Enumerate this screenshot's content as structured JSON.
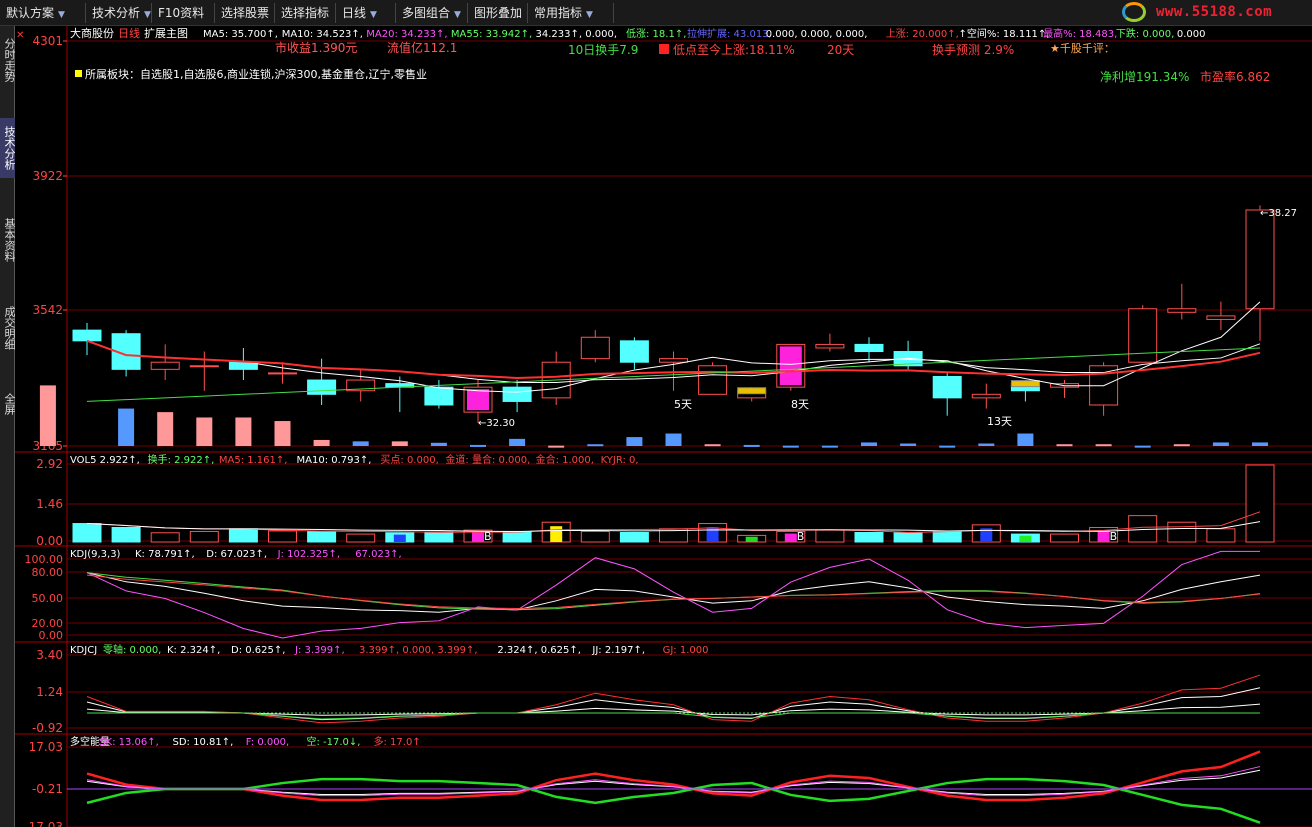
{
  "toolbar": [
    {
      "label": "默认方案",
      "arrow": true
    },
    {
      "label": "技术分析",
      "arrow": true
    },
    {
      "label": "F10资料",
      "arrow": false
    },
    {
      "label": "选择股票",
      "arrow": false
    },
    {
      "label": "选择指标",
      "arrow": false
    },
    {
      "label": "日线",
      "arrow": true
    },
    {
      "label": "多图组合",
      "arrow": true
    },
    {
      "label": "图形叠加",
      "arrow": false
    },
    {
      "label": "常用指标",
      "arrow": true
    }
  ],
  "logo_text": "www.55188.com",
  "sidebar": [
    {
      "label": "分时走势",
      "active": false
    },
    {
      "label": "技术分析",
      "active": true
    },
    {
      "label": "基本资料",
      "active": false
    },
    {
      "label": "成交明细",
      "active": false
    },
    {
      "label": "全屏",
      "active": false
    }
  ],
  "main_panel": {
    "stock_name": "大商股份",
    "period": "日线",
    "indicator": "扩展主图",
    "ma_line": [
      {
        "text": "MA5: 35.700↑,",
        "color": "#ffffff"
      },
      {
        "text": "MA10: 34.523↑,",
        "color": "#ffffff"
      },
      {
        "text": "MA20: 34.233↑,",
        "color": "#ff55ff"
      },
      {
        "text": "MA55: 33.942↑,",
        "color": "#66ff66"
      },
      {
        "text": "34.233↑, 0.000,",
        "color": "#ffffff"
      },
      {
        "text": "低涨: 18.1↑,",
        "color": "#66ff66"
      },
      {
        "text": "拉伸扩展: 43.013,",
        "color": "#6666ff"
      },
      {
        "text": "0.000, 0.000, 0.000,",
        "color": "#ffffff"
      },
      {
        "text": "上涨: 20.000↑,",
        "color": "#ff4444"
      },
      {
        "text": "↑空间%: 18.111↑,",
        "color": "#ffffff"
      },
      {
        "text": "最高%: 18.483,",
        "color": "#ff55ff"
      },
      {
        "text": "下跌: 0.000,",
        "color": "#66ff66"
      },
      {
        "text": "0.000",
        "color": "#ffffff"
      }
    ],
    "info_shiyi": "市收益1.390元",
    "info_liutong": "流值亿112.1",
    "info_huanshou10": "10日换手7.9",
    "info_didian": "低点至今上涨:18.11%",
    "info_days": "20天",
    "info_huanshou_pred": "换手预测 2.9%",
    "info_qiangu": "★千股千评：",
    "info_bankuai": "所属板块：自选股1,自选股6,商业连锁,沪深300,基金重仓,辽宁,零售业",
    "info_jinglirun": "净利增191.34%",
    "info_shiying": "市盈率6.862",
    "y_labels": [
      "4301",
      "3922",
      "3542",
      "3165"
    ],
    "annot_low": "←32.30",
    "annot_high": "←38.27",
    "annot_5": "5天",
    "annot_8": "8天",
    "annot_13": "13天"
  },
  "vol_panel": {
    "header": [
      {
        "text": "VOL5 2.922↑,",
        "color": "#ffffff"
      },
      {
        "text": "换手: 2.922↑,",
        "color": "#66ff66"
      },
      {
        "text": "MA5: 1.161↑,",
        "color": "#ff4444"
      },
      {
        "text": "MA10: 0.793↑,",
        "color": "#ffffff"
      },
      {
        "text": "买点: 0.000,",
        "color": "#ff4444"
      },
      {
        "text": "金道: 量合: 0.000,",
        "color": "#ff4444"
      },
      {
        "text": "金合: 1.000,",
        "color": "#ff4444"
      },
      {
        "text": "KYJR: 0,",
        "color": "#ff4444"
      }
    ],
    "y_labels": [
      "2.92",
      "1.46",
      "0.00"
    ],
    "b_marks": [
      "B",
      "B",
      "B"
    ]
  },
  "kdj_panel": {
    "header": [
      {
        "text": "KDJ(9,3,3)",
        "color": "#ffffff"
      },
      {
        "text": "K: 78.791↑,",
        "color": "#ffffff"
      },
      {
        "text": "D: 67.023↑,",
        "color": "#ffffff"
      },
      {
        "text": "J: 102.325↑,",
        "color": "#ff55ff"
      },
      {
        "text": "67.023↑,",
        "color": "#ff55ff"
      }
    ],
    "y_labels": [
      "100.00",
      "80.00",
      "50.00",
      "20.00",
      "0.00"
    ]
  },
  "kdjcj_panel": {
    "header": [
      {
        "text": "KDJCJ",
        "color": "#ffffff"
      },
      {
        "text": "零轴: 0.000,",
        "color": "#66ff66"
      },
      {
        "text": "K: 2.324↑,",
        "color": "#ffffff"
      },
      {
        "text": "D: 0.625↑,",
        "color": "#ffffff"
      },
      {
        "text": "J: 3.399↑,",
        "color": "#ff55ff"
      },
      {
        "text": "3.399↑, 0.000, 3.399↑,",
        "color": "#ff4444"
      },
      {
        "text": "2.324↑, 0.625↑,",
        "color": "#ffffff"
      },
      {
        "text": "JJ: 2.197↑,",
        "color": "#ffffff"
      },
      {
        "text": "GJ: 1.000",
        "color": "#ff4444"
      }
    ],
    "y_labels": [
      "3.40",
      "1.24",
      "-0.92"
    ]
  },
  "dkn_panel": {
    "header": [
      {
        "text": "多空能量",
        "color": "#ffffff"
      },
      {
        "text": "SK: 13.06↑,",
        "color": "#ff55ff"
      },
      {
        "text": "SD: 10.81↑,",
        "color": "#ffffff"
      },
      {
        "text": "F: 0.000,",
        "color": "#ff55ff"
      },
      {
        "text": "空: -17.0↓,",
        "color": "#66ff66"
      },
      {
        "text": "多: 17.0↑",
        "color": "#ff4444"
      }
    ],
    "y_labels": [
      "17.03",
      "-0.21",
      "-17.03"
    ]
  },
  "chart_data": {
    "type": "candlestick",
    "price_range": [
      31.65,
      43.01
    ],
    "candles": [
      {
        "o": 34.9,
        "c": 34.6,
        "h": 35.1,
        "l": 34.2,
        "up": false
      },
      {
        "o": 34.8,
        "c": 33.8,
        "h": 34.9,
        "l": 33.6,
        "up": false
      },
      {
        "o": 33.8,
        "c": 34.0,
        "h": 34.5,
        "l": 33.5,
        "up": true
      },
      {
        "o": 33.9,
        "c": 33.9,
        "h": 34.3,
        "l": 33.2,
        "up": true
      },
      {
        "o": 34.0,
        "c": 33.8,
        "h": 34.4,
        "l": 33.5,
        "up": false
      },
      {
        "o": 33.7,
        "c": 33.7,
        "h": 34.0,
        "l": 33.4,
        "up": true
      },
      {
        "o": 33.5,
        "c": 33.1,
        "h": 34.1,
        "l": 32.8,
        "up": false
      },
      {
        "o": 33.2,
        "c": 33.5,
        "h": 33.8,
        "l": 32.9,
        "up": true
      },
      {
        "o": 33.4,
        "c": 33.3,
        "h": 33.6,
        "l": 32.6,
        "up": false
      },
      {
        "o": 33.3,
        "c": 32.8,
        "h": 33.5,
        "l": 32.7,
        "up": false
      },
      {
        "o": 32.6,
        "c": 33.3,
        "h": 33.5,
        "l": 32.3,
        "up": true
      },
      {
        "o": 33.3,
        "c": 32.9,
        "h": 33.5,
        "l": 32.6,
        "up": false
      },
      {
        "o": 33.0,
        "c": 34.0,
        "h": 34.3,
        "l": 32.8,
        "up": true
      },
      {
        "o": 34.1,
        "c": 34.7,
        "h": 34.9,
        "l": 34.0,
        "up": true
      },
      {
        "o": 34.6,
        "c": 34.0,
        "h": 34.7,
        "l": 33.8,
        "up": false
      },
      {
        "o": 34.0,
        "c": 34.1,
        "h": 34.3,
        "l": 33.2,
        "up": true
      },
      {
        "o": 33.1,
        "c": 33.9,
        "h": 34.0,
        "l": 33.1,
        "up": true
      },
      {
        "o": 33.0,
        "c": 33.2,
        "h": 33.3,
        "l": 32.9,
        "up": true
      },
      {
        "o": 33.3,
        "c": 34.5,
        "h": 34.5,
        "l": 33.2,
        "up": true
      },
      {
        "o": 34.4,
        "c": 34.5,
        "h": 34.8,
        "l": 34.3,
        "up": true
      },
      {
        "o": 34.5,
        "c": 34.3,
        "h": 34.7,
        "l": 34.0,
        "up": false
      },
      {
        "o": 34.3,
        "c": 33.9,
        "h": 34.6,
        "l": 33.8,
        "up": false
      },
      {
        "o": 33.6,
        "c": 33.0,
        "h": 33.7,
        "l": 32.5,
        "up": false
      },
      {
        "o": 33.0,
        "c": 33.1,
        "h": 33.4,
        "l": 32.7,
        "up": true
      },
      {
        "o": 33.2,
        "c": 33.4,
        "h": 33.5,
        "l": 32.9,
        "up": false
      },
      {
        "o": 33.4,
        "c": 33.3,
        "h": 33.5,
        "l": 33.0,
        "up": true
      },
      {
        "o": 32.8,
        "c": 33.9,
        "h": 34.0,
        "l": 32.5,
        "up": true
      },
      {
        "o": 34.0,
        "c": 35.5,
        "h": 35.6,
        "l": 34.0,
        "up": true
      },
      {
        "o": 35.4,
        "c": 35.5,
        "h": 36.2,
        "l": 35.2,
        "up": true
      },
      {
        "o": 35.2,
        "c": 35.3,
        "h": 35.7,
        "l": 34.9,
        "up": true
      },
      {
        "o": 35.5,
        "c": 38.27,
        "h": 38.4,
        "l": 34.6,
        "up": true
      }
    ],
    "volume_max": 2.92
  }
}
